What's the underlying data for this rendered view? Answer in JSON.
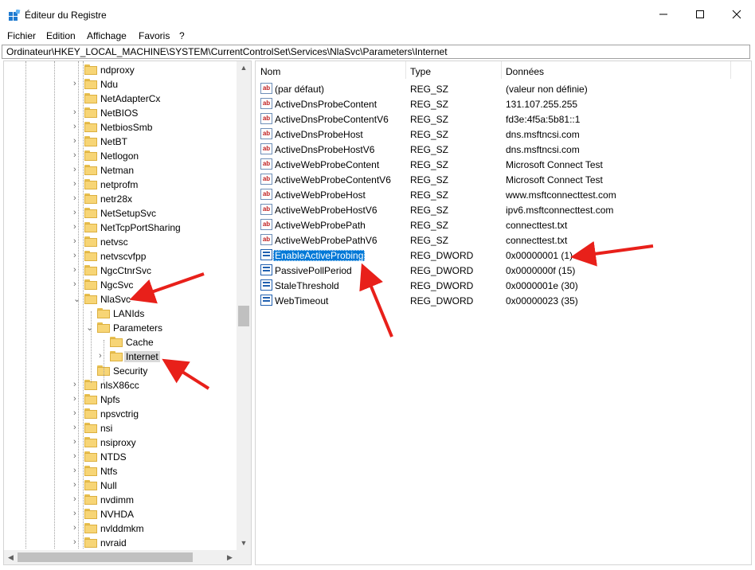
{
  "window": {
    "title": "Éditeur du Registre",
    "icon": "registry-icon"
  },
  "menu": [
    "Fichier",
    "Edition",
    "Affichage",
    "Favoris",
    "?"
  ],
  "address": "Ordinateur\\HKEY_LOCAL_MACHINE\\SYSTEM\\CurrentControlSet\\Services\\NlaSvc\\Parameters\\Internet",
  "tree": [
    {
      "label": "ndproxy",
      "level": 0,
      "expander": "none"
    },
    {
      "label": "Ndu",
      "level": 0,
      "expander": "collapsed"
    },
    {
      "label": "NetAdapterCx",
      "level": 0,
      "expander": "none"
    },
    {
      "label": "NetBIOS",
      "level": 0,
      "expander": "collapsed"
    },
    {
      "label": "NetbiosSmb",
      "level": 0,
      "expander": "collapsed"
    },
    {
      "label": "NetBT",
      "level": 0,
      "expander": "collapsed"
    },
    {
      "label": "Netlogon",
      "level": 0,
      "expander": "collapsed"
    },
    {
      "label": "Netman",
      "level": 0,
      "expander": "collapsed"
    },
    {
      "label": "netprofm",
      "level": 0,
      "expander": "collapsed"
    },
    {
      "label": "netr28x",
      "level": 0,
      "expander": "collapsed"
    },
    {
      "label": "NetSetupSvc",
      "level": 0,
      "expander": "collapsed"
    },
    {
      "label": "NetTcpPortSharing",
      "level": 0,
      "expander": "collapsed"
    },
    {
      "label": "netvsc",
      "level": 0,
      "expander": "collapsed"
    },
    {
      "label": "netvscvfpp",
      "level": 0,
      "expander": "collapsed"
    },
    {
      "label": "NgcCtnrSvc",
      "level": 0,
      "expander": "collapsed"
    },
    {
      "label": "NgcSvc",
      "level": 0,
      "expander": "collapsed"
    },
    {
      "label": "NlaSvc",
      "level": 0,
      "expander": "expanded"
    },
    {
      "label": "LANIds",
      "level": 1,
      "expander": "none"
    },
    {
      "label": "Parameters",
      "level": 1,
      "expander": "expanded"
    },
    {
      "label": "Cache",
      "level": 2,
      "expander": "none"
    },
    {
      "label": "Internet",
      "level": 2,
      "expander": "collapsed",
      "selected": true
    },
    {
      "label": "Security",
      "level": 1,
      "expander": "none"
    },
    {
      "label": "nlsX86cc",
      "level": 0,
      "expander": "collapsed"
    },
    {
      "label": "Npfs",
      "level": 0,
      "expander": "collapsed"
    },
    {
      "label": "npsvctrig",
      "level": 0,
      "expander": "collapsed"
    },
    {
      "label": "nsi",
      "level": 0,
      "expander": "collapsed"
    },
    {
      "label": "nsiproxy",
      "level": 0,
      "expander": "collapsed"
    },
    {
      "label": "NTDS",
      "level": 0,
      "expander": "collapsed"
    },
    {
      "label": "Ntfs",
      "level": 0,
      "expander": "collapsed"
    },
    {
      "label": "Null",
      "level": 0,
      "expander": "collapsed"
    },
    {
      "label": "nvdimm",
      "level": 0,
      "expander": "collapsed"
    },
    {
      "label": "NVHDA",
      "level": 0,
      "expander": "collapsed"
    },
    {
      "label": "nvlddmkm",
      "level": 0,
      "expander": "collapsed"
    },
    {
      "label": "nvraid",
      "level": 0,
      "expander": "collapsed"
    }
  ],
  "columns": [
    "Nom",
    "Type",
    "Données"
  ],
  "values": [
    {
      "name": "(par défaut)",
      "type": "REG_SZ",
      "data": "(valeur non définie)"
    },
    {
      "name": "ActiveDnsProbeContent",
      "type": "REG_SZ",
      "data": "131.107.255.255"
    },
    {
      "name": "ActiveDnsProbeContentV6",
      "type": "REG_SZ",
      "data": "fd3e:4f5a:5b81::1"
    },
    {
      "name": "ActiveDnsProbeHost",
      "type": "REG_SZ",
      "data": "dns.msftncsi.com"
    },
    {
      "name": "ActiveDnsProbeHostV6",
      "type": "REG_SZ",
      "data": "dns.msftncsi.com"
    },
    {
      "name": "ActiveWebProbeContent",
      "type": "REG_SZ",
      "data": "Microsoft Connect Test"
    },
    {
      "name": "ActiveWebProbeContentV6",
      "type": "REG_SZ",
      "data": "Microsoft Connect Test"
    },
    {
      "name": "ActiveWebProbeHost",
      "type": "REG_SZ",
      "data": "www.msftconnecttest.com"
    },
    {
      "name": "ActiveWebProbeHostV6",
      "type": "REG_SZ",
      "data": "ipv6.msftconnecttest.com"
    },
    {
      "name": "ActiveWebProbePath",
      "type": "REG_SZ",
      "data": "connecttest.txt"
    },
    {
      "name": "ActiveWebProbePathV6",
      "type": "REG_SZ",
      "data": "connecttest.txt"
    },
    {
      "name": "EnableActiveProbing",
      "type": "REG_DWORD",
      "data": "0x00000001 (1)",
      "selected": true
    },
    {
      "name": "PassivePollPeriod",
      "type": "REG_DWORD",
      "data": "0x0000000f (15)"
    },
    {
      "name": "StaleThreshold",
      "type": "REG_DWORD",
      "data": "0x0000001e (30)"
    },
    {
      "name": "WebTimeout",
      "type": "REG_DWORD",
      "data": "0x00000023 (35)"
    }
  ],
  "colors": {
    "selection": "#0078d7",
    "annotation_arrow": "#e8201a",
    "folder": "#f7d576"
  }
}
